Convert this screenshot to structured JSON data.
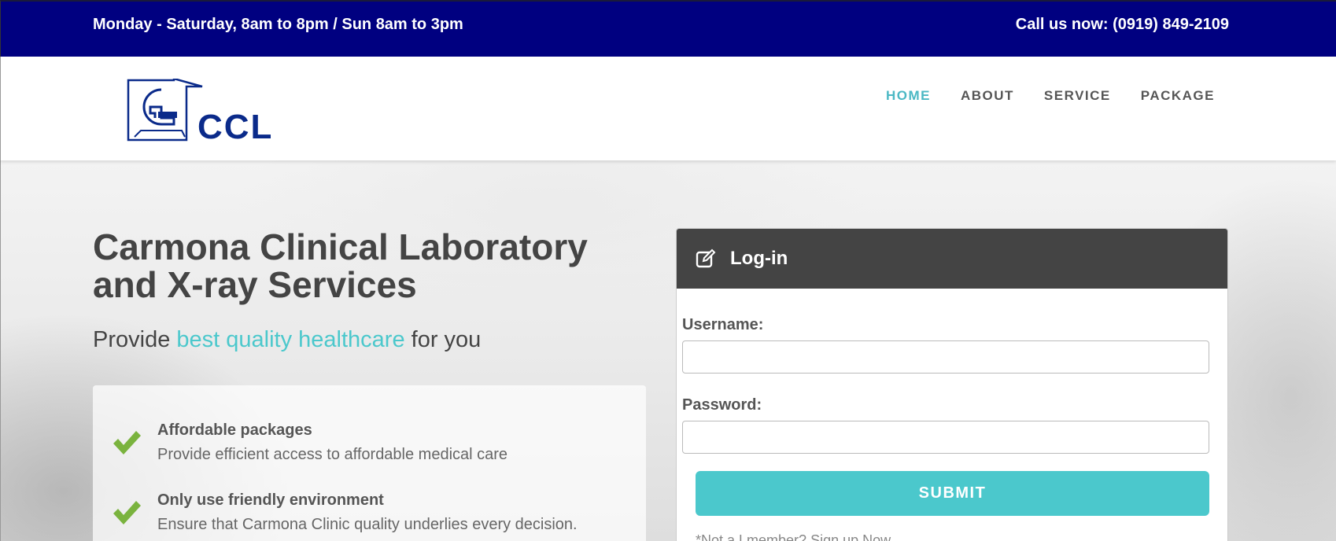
{
  "topbar": {
    "hours": "Monday - Saturday, 8am to 8pm / Sun 8am to 3pm",
    "phone": "Call us now: (0919) 849-2109",
    "bg_color": "#000080"
  },
  "header": {
    "logo_text": "CCL",
    "nav": [
      {
        "label": "HOME",
        "active": true
      },
      {
        "label": "ABOUT",
        "active": false
      },
      {
        "label": "SERVICE",
        "active": false
      },
      {
        "label": "PACKAGE",
        "active": false
      }
    ]
  },
  "hero": {
    "title": "Carmona Clinical Laboratory and X-ray Services",
    "subtitle_before": "Provide ",
    "subtitle_highlight": "best quality healthcare",
    "subtitle_after": " for you",
    "features": [
      {
        "icon": "check-icon",
        "title": "Affordable packages",
        "desc": "Provide efficient access to affordable medical care"
      },
      {
        "icon": "check-icon",
        "title": "Only use friendly environment",
        "desc": "Ensure that Carmona Clinic quality underlies every decision."
      }
    ]
  },
  "login": {
    "icon": "edit-icon",
    "title": "Log-in",
    "username_label": "Username:",
    "username_value": "",
    "password_label": "Password:",
    "password_value": "",
    "submit_label": "SUBMIT",
    "note": "*Not a Lmember? Sign up Now"
  },
  "colors": {
    "accent": "#4bc8cc",
    "dark": "#444444",
    "check": "#7ab33e"
  }
}
